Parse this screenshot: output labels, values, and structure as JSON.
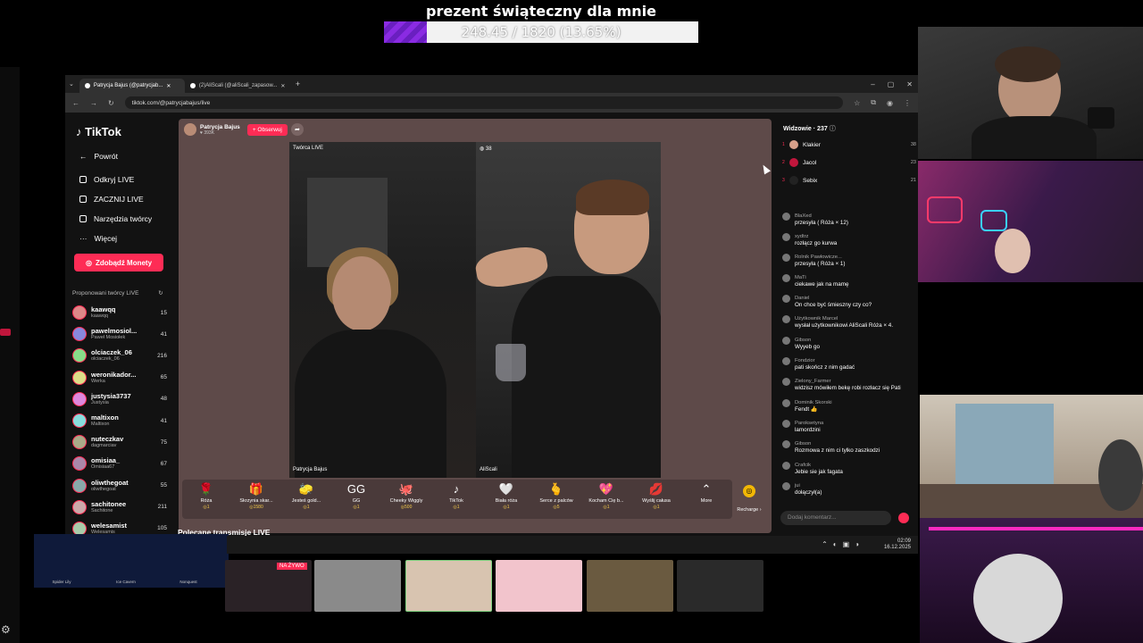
{
  "overlay": {
    "goal_title": "prezent świąteczny dla mnie",
    "goal_text": "248.45 / 1820 (13.65%)",
    "goal_fraction": 0.1365,
    "fill_color": "#8a2be2"
  },
  "browser": {
    "tabs": [
      {
        "label": "Patrycja Bajus (@patrycjab..."
      },
      {
        "label": "(2)AliScali (@aliScali_zapasow..."
      }
    ],
    "new_tab": "+",
    "url": "tiktok.com/@patrycjabajus/live",
    "window_controls": [
      "–",
      "▢",
      "✕"
    ]
  },
  "sidebar": {
    "logo": "TikTok",
    "nav": [
      {
        "label": "Powrót",
        "icon": "back-arrow-icon"
      },
      {
        "label": "Odkryj LIVE",
        "icon": "live-icon"
      },
      {
        "label": "ZACZNIJ LIVE",
        "icon": "camera-icon"
      },
      {
        "label": "Narzędzia twórcy",
        "icon": "tools-icon"
      },
      {
        "label": "Więcej",
        "icon": "more-icon"
      }
    ],
    "coins_button": "Zdobądź Monety",
    "recommended_header": "Proponowani twórcy LIVE",
    "recommended": [
      {
        "name": "kaawqq",
        "sub": "kaawqq",
        "count": "15"
      },
      {
        "name": "pawelmosiol...",
        "sub": "Paweł Mosiołek",
        "count": "41"
      },
      {
        "name": "olciaczek_06",
        "sub": "olciaczek_06",
        "count": "216"
      },
      {
        "name": "weronikador...",
        "sub": "Werka",
        "count": "65"
      },
      {
        "name": "justysia3737",
        "sub": "Justysia",
        "count": "48"
      },
      {
        "name": "maltixon",
        "sub": "Maltixon",
        "count": "41"
      },
      {
        "name": "nuteczkav",
        "sub": "dagmarciav",
        "count": "75"
      },
      {
        "name": "omisiaa_",
        "sub": "Omisiaa67",
        "count": "67"
      },
      {
        "name": "oliwthegoat",
        "sub": "oliwthegoat",
        "count": "55"
      },
      {
        "name": "sachitonee",
        "sub": "Sachitone",
        "count": "211"
      },
      {
        "name": "welesamist",
        "sub": "Welesamis",
        "count": "105"
      }
    ]
  },
  "live": {
    "host_name": "Patrycja Bajus",
    "host_sub": "393K",
    "follow_label": "+ Obserwuj",
    "left_badge": "Twórca LIVE",
    "right_badge": "38",
    "left_name": "Patrycja Bajus",
    "right_name": "AliScali",
    "gifts": [
      {
        "name": "Róża",
        "price": "1",
        "icon": "🌹"
      },
      {
        "name": "Skrzynia skar...",
        "price": "1580",
        "icon": "🎁"
      },
      {
        "name": "Jesteś gold...",
        "price": "1",
        "icon": "🧽"
      },
      {
        "name": "GG",
        "price": "1",
        "icon": "GG"
      },
      {
        "name": "Cheeky Wiggly",
        "price": "500",
        "icon": "🐙"
      },
      {
        "name": "TikTok",
        "price": "1",
        "icon": "♪"
      },
      {
        "name": "Biała róża",
        "price": "1",
        "icon": "🤍"
      },
      {
        "name": "Serce z palców",
        "price": "5",
        "icon": "🫰"
      },
      {
        "name": "Kocham Cię b...",
        "price": "1",
        "icon": "💖"
      },
      {
        "name": "Wyślij całusa",
        "price": "1",
        "icon": "💋"
      },
      {
        "name": "More",
        "price": "",
        "icon": "⌃"
      }
    ],
    "recharge_label": "Recharge ›",
    "below_title": "Polecane transmisje LIVE"
  },
  "chat": {
    "viewers_header": "Widzowie · 237",
    "top_viewers": [
      {
        "rank": "1",
        "name": "Klakier",
        "count": "38",
        "color": "#d7a08a"
      },
      {
        "rank": "2",
        "name": "Jacol",
        "count": "23",
        "color": "#c0163c"
      },
      {
        "rank": "3",
        "name": "Sebix",
        "count": "21",
        "color": "#222"
      }
    ],
    "messages": [
      {
        "user": "BlaXed",
        "text": "przesyła ( Róża × 12)"
      },
      {
        "user": "xydtrz",
        "text": "rozłącz go kurwa"
      },
      {
        "user": "Rolnik Pawłowicze...",
        "text": "przesyła ( Róża × 1)"
      },
      {
        "user": "MaTi",
        "text": "ciekawe jak na mamę"
      },
      {
        "user": "Daniel",
        "text": "On chce być śmieszny czy co?"
      },
      {
        "user": "Użytkownik Marcel",
        "text": "wysłał użytkownikowi AliScali Róża × 4."
      },
      {
        "user": "Gibson",
        "text": "Wyyeb go"
      },
      {
        "user": "Fondzior",
        "text": "pati skończ z nim gadać"
      },
      {
        "user": "Zielony_Farmer",
        "text": "widzisz mówiłem bekę robi rozłacz się Pati"
      },
      {
        "user": "Dominik Skorski",
        "text": "Fendt 👍"
      },
      {
        "user": "Paroksetyna",
        "text": "lamordzini"
      },
      {
        "user": "Gibson",
        "text": "Rozmowa z nim ci tylko zaszkodzi"
      },
      {
        "user": "Crafcik",
        "text": "Jebie sie jak fagata"
      },
      {
        "user": "jui",
        "text": "dołączył(a)"
      }
    ],
    "input_placeholder": "Dodaj komentarz..."
  },
  "taskbar": {
    "time": "02:09",
    "date": "16.12.2025",
    "live_tag": "NA ŻYWO"
  },
  "skins": [
    {
      "label": "Spider Lily"
    },
    {
      "label": "Ice Cavern"
    },
    {
      "label": "Nonquest"
    }
  ]
}
